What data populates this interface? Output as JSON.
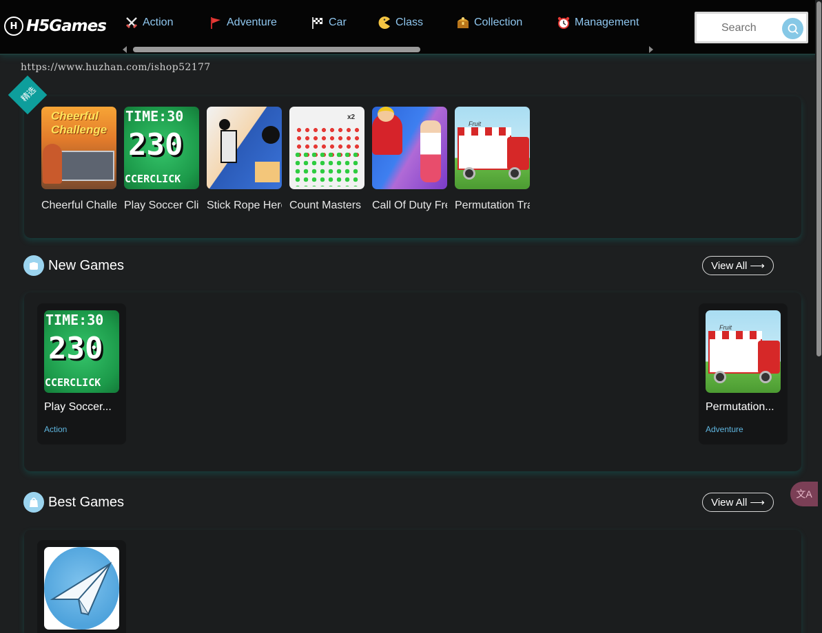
{
  "header": {
    "logo_mark": "H",
    "logo_text": "H5Games",
    "nav": [
      {
        "label": "Action",
        "icon": "swords-icon"
      },
      {
        "label": "Adventure",
        "icon": "flag-icon"
      },
      {
        "label": "Car",
        "icon": "checkered-flag-icon"
      },
      {
        "label": "Class",
        "icon": "pacman-icon"
      },
      {
        "label": "Collection",
        "icon": "treasure-chest-icon"
      },
      {
        "label": "Management",
        "icon": "alarm-clock-icon"
      }
    ],
    "search_placeholder": "Search"
  },
  "url_text": "https://www.huzhan.com/ishop52177",
  "featured": {
    "ribbon": "精选",
    "games": [
      {
        "title": "Cheerful Challenge",
        "thumb_text": "Cheerful Challenge"
      },
      {
        "title": "Play Soccer Click",
        "thumb_text_top": "TIME:30",
        "thumb_text_mid": "230",
        "thumb_text_bot": "CCERCLICK"
      },
      {
        "title": "Stick Rope Hero"
      },
      {
        "title": "Count Masters",
        "thumb_text": "x2"
      },
      {
        "title": "Call Of Duty Free"
      },
      {
        "title": "Permutation Train",
        "thumb_text": "Fruit"
      }
    ]
  },
  "new_games": {
    "title": "New Games",
    "view_all": "View All",
    "cards": [
      {
        "name": "Play Soccer Click",
        "display": "Play Soccer...",
        "category": "Action",
        "thumb_text_top": "TIME:30",
        "thumb_text_mid": "230",
        "thumb_text_bot": "CCERCLICK"
      },
      {
        "name": "Permutation Train",
        "display": "Permutation...",
        "category": "Adventure",
        "thumb_text": "Fruit"
      }
    ]
  },
  "best_games": {
    "title": "Best Games",
    "view_all": "View All"
  },
  "translate_icon": "translate-icon",
  "colors": {
    "background": "#1d1f20",
    "nav_text": "#8fc6ee",
    "accent": "#0e9e9c",
    "category": "#5fb6e0"
  }
}
